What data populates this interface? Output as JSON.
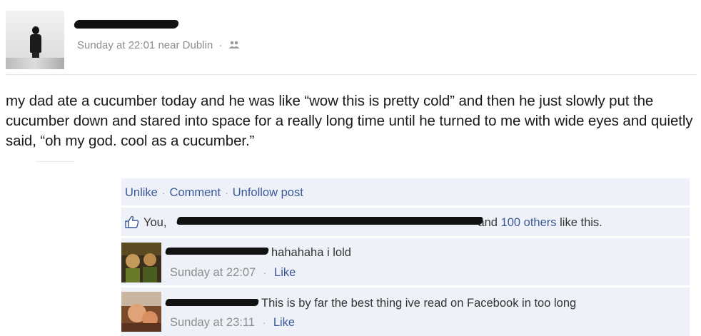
{
  "post": {
    "author_redacted": true,
    "timestamp": "Sunday at 22:01",
    "location_prefix": "near",
    "location": "Dublin",
    "separator": "·",
    "privacy_icon": "friends-icon",
    "text": "my dad ate a cucumber today and he was like “wow this is pretty cold” and then he just slowly put the cucumber down and stared into space for a really long time until he turned to me with wide eyes and quietly said, “oh my god. cool as a cucumber.”"
  },
  "actions": {
    "unlike": "Unlike",
    "comment": "Comment",
    "unfollow": "Unfollow post",
    "separator": "·"
  },
  "likes": {
    "icon": "thumbs-up-icon",
    "prefix": "You,",
    "joiner": "and",
    "others": "100 others",
    "suffix": "like this."
  },
  "comments": [
    {
      "text": "hahahaha i lold",
      "time": "Sunday at 22:07",
      "separator": "·",
      "like": "Like"
    },
    {
      "text": "This is by far the best thing ive read on Facebook in too long",
      "time": "Sunday at 23:11",
      "separator": "·",
      "like": "Like"
    }
  ],
  "colors": {
    "link": "#3b5998",
    "meta": "#8c8c8c",
    "panel": "#eef1f7"
  }
}
